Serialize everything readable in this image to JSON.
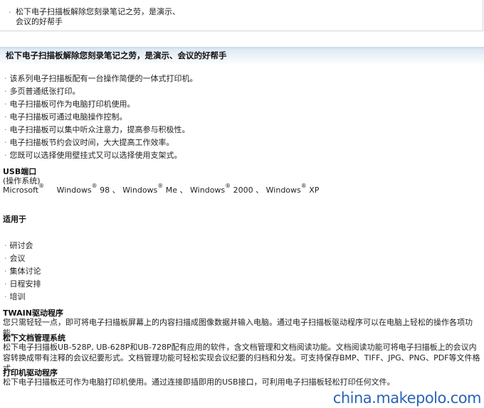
{
  "top": {
    "lines": [
      "松下电子扫描板解除您刻录笔记之劳，是演示、",
      "会议的好帮手"
    ]
  },
  "section_title": "松下电子扫描板解除您刻录笔记之劳，是演示、会议的好帮手",
  "features": [
    "该系列电子扫描板配有一台操作简便的一体式打印机。",
    "多页普通纸张打印。",
    "电子扫描板可作为电脑打印机使用。",
    "电子扫描板可通过电脑操作控制。",
    "电子扫描板可以集中听众注意力，提高参与积极性。",
    "电子扫描板节约会议时间，大大提高工作效率。",
    "您既可以选择使用壁挂式又可以选择使用支架式。"
  ],
  "usb": {
    "heading": "USB端口",
    "sub": "(操作系统)",
    "os": [
      {
        "name": "Microsoft",
        "sup": "®",
        "after": "  "
      },
      {
        "name": "Windows",
        "sup": "®",
        "after": " 98 、"
      },
      {
        "name": "Windows",
        "sup": "®",
        "after": " Me 、"
      },
      {
        "name": "Windows",
        "sup": "®",
        "after": " 2000 、"
      },
      {
        "name": "Windows",
        "sup": "®",
        "after": " XP"
      }
    ]
  },
  "applicable": {
    "heading": "适用于",
    "items": [
      "研讨会",
      "会议",
      "集体讨论",
      "日程安排",
      "培训"
    ]
  },
  "twain": {
    "heading": "TWAIN驱动程序",
    "text": "您只需轻轻一点，即可将电子扫描板屏幕上的内容扫描成图像数据并输入电脑。通过电子扫描板驱动程序可以在电脑上轻松的操作各项功能。"
  },
  "docmgmt": {
    "heading": "松下文档管理系统",
    "text": "松下电子扫描板UB-528P, UB-628P和UB-728P配有应用的软件，含文档管理和文档阅读功能。文档阅读功能可将电子扫描板上的会议内容转换成带有注释的会议纪要形式。文档管理功能可轻松实现会议纪要的归档和分发。可支持保存BMP、TIFF、JPG、PNG、PDF等文件格式。"
  },
  "printer": {
    "heading": "打印机驱动程序",
    "text": "松下电子扫描板还可作为电脑打印机使用。通过连接即插即用的USB接口，可利用电子扫描板轻松打印任何文件。"
  },
  "watermark": "china.makepolo.com",
  "colors": {
    "watermark": "#2b63b8",
    "band": "#c8d6e6"
  }
}
